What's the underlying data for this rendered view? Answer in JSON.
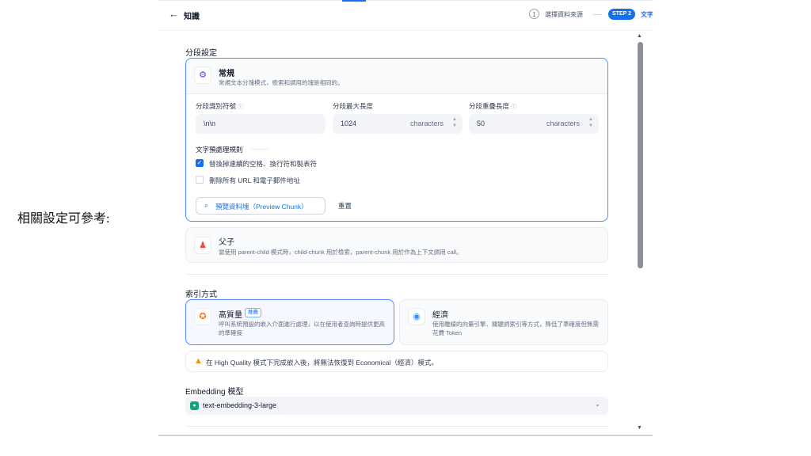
{
  "caption": "相關設定可參考:",
  "header": {
    "back_icon": "arrow-left-icon",
    "title": "知識",
    "step1_number": "1",
    "step1_label": "選擇資料來源",
    "step2_badge": "STEP 2",
    "step2_label": "文字"
  },
  "segment": {
    "section_title": "分段設定",
    "general": {
      "title": "常規",
      "desc": "常規文本分塊模式，檢索和調用的塊是相同的。",
      "separator_label": "分段識別符號",
      "separator_value": "\\n\\n",
      "maxlen_label": "分段最大長度",
      "maxlen_value": "1024",
      "maxlen_unit": "characters",
      "overlap_label": "分段重疊長度",
      "overlap_value": "50",
      "overlap_unit": "characters",
      "rules_title": "文字預處理規則",
      "rule1": "替換掉連續的空格、換行符和製表符",
      "rule1_checked": true,
      "rule2": "刪除所有 URL 和電子郵件地址",
      "rule2_checked": false,
      "preview_button": "預覽資料塊（Preview Chunk）",
      "reset_button": "重置"
    },
    "parent_child": {
      "title": "父子",
      "desc": "當使用 parent-child 模式時，child-chunk 用於檢索，parent-chunk 用於作為上下文調用 call。"
    }
  },
  "index": {
    "section_title": "索引方式",
    "hq_title": "高質量",
    "hq_badge": "推薦",
    "hq_desc": "呼叫系統預設的嵌入介面進行處理，以在使用者查詢時提供更高的準確度",
    "eco_title": "經濟",
    "eco_desc": "使用離線的向量引擎、關鍵詞索引等方式，降低了準確度但無需花費 Token",
    "warning": "在 High Quality 模式下完成嵌入後，將無法恢復到 Economical（經濟）模式。"
  },
  "embedding": {
    "label": "Embedding 模型",
    "value": "text-embedding-3-large"
  },
  "colors": {
    "accent": "#1570ef",
    "border_active": "#528bff",
    "warning": "#f79009"
  }
}
